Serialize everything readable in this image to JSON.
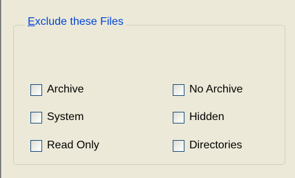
{
  "group": {
    "title": "Exclude these Files",
    "title_accelerator": "E"
  },
  "checkboxes": [
    {
      "label": "Archive",
      "checked": false
    },
    {
      "label": "System",
      "checked": false
    },
    {
      "label": "Read Only",
      "checked": false
    },
    {
      "label": "No Archive",
      "checked": false
    },
    {
      "label": "Hidden",
      "checked": false
    },
    {
      "label": "Directories",
      "checked": false
    }
  ],
  "colors": {
    "dialog_background": "#ece9d8",
    "group_title": "#0046d5",
    "group_border": "#d0d0bf",
    "checkbox_border": "#1c5180"
  }
}
